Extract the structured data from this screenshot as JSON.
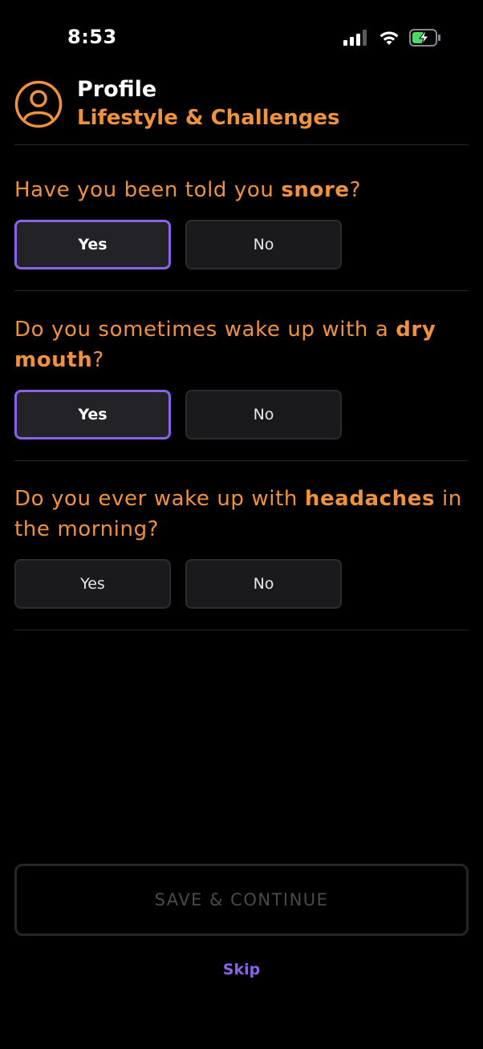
{
  "status_bar": {
    "time": "8:53",
    "icons": [
      "cellular-signal-icon",
      "wifi-icon",
      "battery-charging-icon"
    ]
  },
  "header": {
    "title": "Profile",
    "subtitle": "Lifestyle & Challenges",
    "icon": "user-avatar-icon"
  },
  "questions": [
    {
      "prefix": "Have you been told you ",
      "emphasis": "snore",
      "suffix": "?",
      "options": [
        "Yes",
        "No"
      ],
      "selected": "Yes"
    },
    {
      "prefix": "Do you sometimes wake up with a ",
      "emphasis": "dry mouth",
      "suffix": "?",
      "options": [
        "Yes",
        "No"
      ],
      "selected": "Yes"
    },
    {
      "prefix": "Do you ever wake up with ",
      "emphasis": "headaches",
      "suffix": " in the morning?",
      "options": [
        "Yes",
        "No"
      ],
      "selected": null
    }
  ],
  "footer": {
    "save_label": "SAVE & CONTINUE",
    "skip_label": "Skip"
  },
  "colors": {
    "accent_orange": "#f0913d",
    "accent_purple": "#8a63e8",
    "background": "#000000",
    "button_bg": "#1a1a1d"
  }
}
